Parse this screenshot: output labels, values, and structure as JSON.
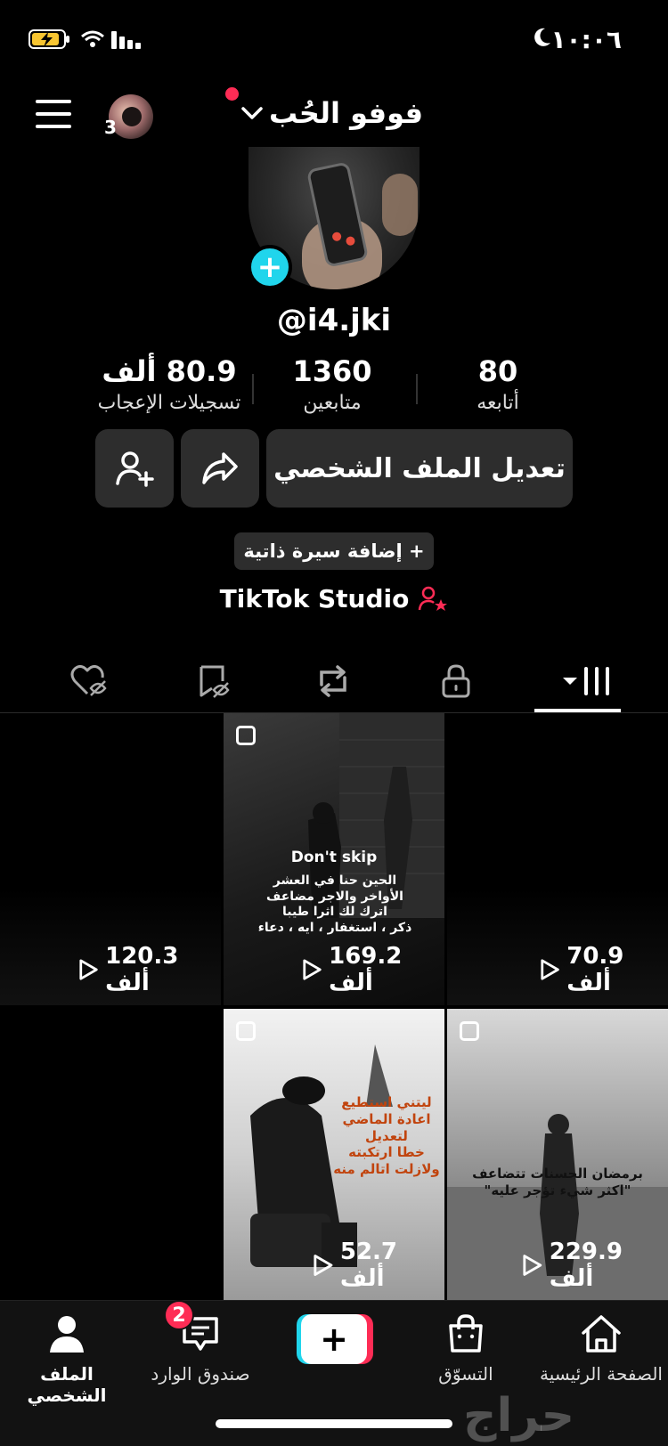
{
  "status_bar": {
    "time": "١٠:٠٦"
  },
  "header": {
    "notifications_count": "3",
    "name": "فوفو الحُب"
  },
  "profile": {
    "username": "@i4.jki"
  },
  "stats": [
    {
      "value": "80",
      "label": "أتابعه"
    },
    {
      "value": "1360",
      "label": "متابعين"
    },
    {
      "value": "80.9 ألف",
      "label": "تسجيلات الإعجاب"
    }
  ],
  "actions": {
    "edit_profile": "تعديل الملف الشخصي",
    "add_bio": "+ إضافة سيرة ذاتية",
    "studio": "TikTok Studio"
  },
  "tabs": [
    "videos-grid",
    "private",
    "reposts",
    "favorites",
    "liked"
  ],
  "videos": [
    {
      "views": "70.9 ألف",
      "overlay": ""
    },
    {
      "views": "169.2 ألف",
      "overlay_title": "Don't skip",
      "overlay": "الحين حنا في العشر\nالأواخر والاجر مضاعف\nاترك لك اثرا طيبا\nذكر ، استغفار ، ايه ، دعاء"
    },
    {
      "views": "120.3 ألف",
      "overlay": ""
    },
    {
      "views": "229.9 ألف",
      "overlay": "برمضان الحسنات تتضاعف\n\"اكثر شيء تؤجر عليه\""
    },
    {
      "views": "52.7 ألف",
      "overlay": "ليتني استطيع\nاعادة الماضي\nلتعديل\nخطا ارتكبته\nولازلت اتالم منه"
    },
    {
      "views": "",
      "overlay": ""
    }
  ],
  "bottom_nav": {
    "home": "الصفحة الرئيسية",
    "shop": "التسوّق",
    "inbox": "صندوق الوارد",
    "inbox_badge": "2",
    "profile": "الملف الشخصي"
  },
  "watermark": "حراج",
  "colors": {
    "accent_red": "#fe2c55",
    "accent_cyan": "#20d5ec",
    "button_bg": "#2d2d2d"
  }
}
